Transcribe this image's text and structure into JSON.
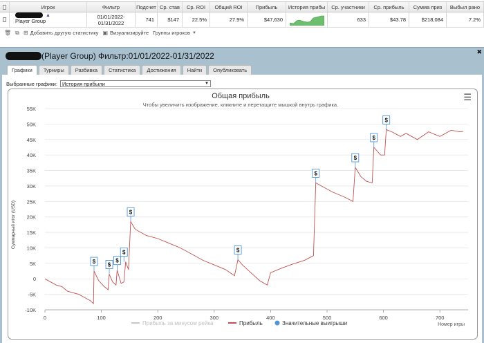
{
  "stats_table": {
    "headers": [
      "Игрок",
      "Фильтр",
      "Подсчет",
      "Ср. став",
      "Ср. ROI",
      "Общий ROI",
      "Прибыль",
      "История прибы",
      "Ср. участники",
      "Ср. прибыль",
      "Сумма приз",
      "Выбыл рано"
    ],
    "row": {
      "player": "Player Group",
      "filter_line1": "01/01/2022-",
      "filter_line2": "01/31/2022",
      "count": "741",
      "avg_stake": "$147",
      "avg_roi": "22.5%",
      "total_roi": "27.9%",
      "profit": "$47,630",
      "avg_entrants": "633",
      "avg_profit": "$43.78",
      "prize_sum": "$218,084",
      "early_exit": "7.2%"
    },
    "colors": {
      "sparkline": "#3a9a3a"
    }
  },
  "toolbar": {
    "add_stats": "Добавить другую статистику",
    "visualize": "Визуализируйте",
    "player_groups": "Группы игроков"
  },
  "panel": {
    "title": "(Player Group) Фильтр:01/01/2022-01/31/2022",
    "tabs": [
      "Графики",
      "Турниры",
      "Разбивка",
      "Статистика",
      "Достижения",
      "Найти",
      "Опубликовать"
    ],
    "selected_chart_label": "Выбранные графики:",
    "selected_chart_value": "История прибыли"
  },
  "chart_data": {
    "type": "line",
    "title": "Общая прибыль",
    "subtitle": "Чтобы увеличить изображение, кликните и перетащите мышкой внутрь графика.",
    "ylabel": "Суммарный итог (USD)",
    "xlabel": "Номер игры",
    "xlim": [
      0,
      750
    ],
    "ylim": [
      -10000,
      55000
    ],
    "x_ticks": [
      0,
      100,
      200,
      300,
      400,
      500,
      600,
      700
    ],
    "y_ticks": [
      -10000,
      -5000,
      0,
      5000,
      10000,
      15000,
      20000,
      25000,
      30000,
      35000,
      40000,
      45000,
      50000,
      55000
    ],
    "y_tick_labels": [
      "-10K",
      "-5K",
      "0",
      "5K",
      "10K",
      "15K",
      "20K",
      "25K",
      "30K",
      "35K",
      "40K",
      "45K",
      "50K",
      "55K"
    ],
    "legend": [
      "Прибыль за минусом рейка",
      "Прибыль",
      "Значительные выигрыши"
    ],
    "legend_placement": "bottom-center",
    "colors": {
      "profit": "#c0504d",
      "rake_line": "#c8c8c8",
      "big_win": "#4f95d8"
    },
    "big_win_marker": "$",
    "series": [
      {
        "name": "Прибыль",
        "points": [
          [
            0,
            0
          ],
          [
            10,
            -1000
          ],
          [
            20,
            -2000
          ],
          [
            30,
            -2500
          ],
          [
            40,
            -4000
          ],
          [
            50,
            -4500
          ],
          [
            60,
            -5000
          ],
          [
            70,
            -6000
          ],
          [
            80,
            -7000
          ],
          [
            86,
            -8000
          ],
          [
            87,
            2500
          ],
          [
            95,
            -500
          ],
          [
            105,
            -2500
          ],
          [
            112,
            -3500
          ],
          [
            114,
            1500
          ],
          [
            120,
            -1000
          ],
          [
            126,
            -2000
          ],
          [
            128,
            2800
          ],
          [
            135,
            -1500
          ],
          [
            140,
            -1000
          ],
          [
            143,
            5500
          ],
          [
            148,
            3000
          ],
          [
            152,
            18500
          ],
          [
            160,
            16000
          ],
          [
            170,
            15000
          ],
          [
            180,
            14000
          ],
          [
            200,
            13000
          ],
          [
            220,
            11500
          ],
          [
            240,
            10000
          ],
          [
            260,
            8000
          ],
          [
            280,
            6000
          ],
          [
            300,
            4500
          ],
          [
            320,
            3000
          ],
          [
            336,
            1000
          ],
          [
            342,
            6200
          ],
          [
            350,
            4500
          ],
          [
            365,
            2000
          ],
          [
            380,
            -500
          ],
          [
            394,
            -2000
          ],
          [
            400,
            2000
          ],
          [
            420,
            3500
          ],
          [
            440,
            4800
          ],
          [
            460,
            6000
          ],
          [
            476,
            7500
          ],
          [
            480,
            31000
          ],
          [
            490,
            30000
          ],
          [
            510,
            28000
          ],
          [
            530,
            26500
          ],
          [
            546,
            25000
          ],
          [
            550,
            36000
          ],
          [
            560,
            33000
          ],
          [
            570,
            31500
          ],
          [
            580,
            31000
          ],
          [
            583,
            42500
          ],
          [
            595,
            40000
          ],
          [
            602,
            40000
          ],
          [
            605,
            48200
          ],
          [
            615,
            47500
          ],
          [
            630,
            46000
          ],
          [
            640,
            47000
          ],
          [
            660,
            45000
          ],
          [
            680,
            47500
          ],
          [
            700,
            46000
          ],
          [
            720,
            48000
          ],
          [
            735,
            47500
          ],
          [
            741,
            47630
          ]
        ]
      }
    ],
    "big_wins": [
      [
        87,
        2500
      ],
      [
        114,
        1500
      ],
      [
        128,
        2800
      ],
      [
        140,
        5500
      ],
      [
        152,
        18500
      ],
      [
        342,
        6200
      ],
      [
        480,
        31000
      ],
      [
        550,
        36000
      ],
      [
        583,
        42500
      ],
      [
        605,
        48200
      ]
    ]
  }
}
